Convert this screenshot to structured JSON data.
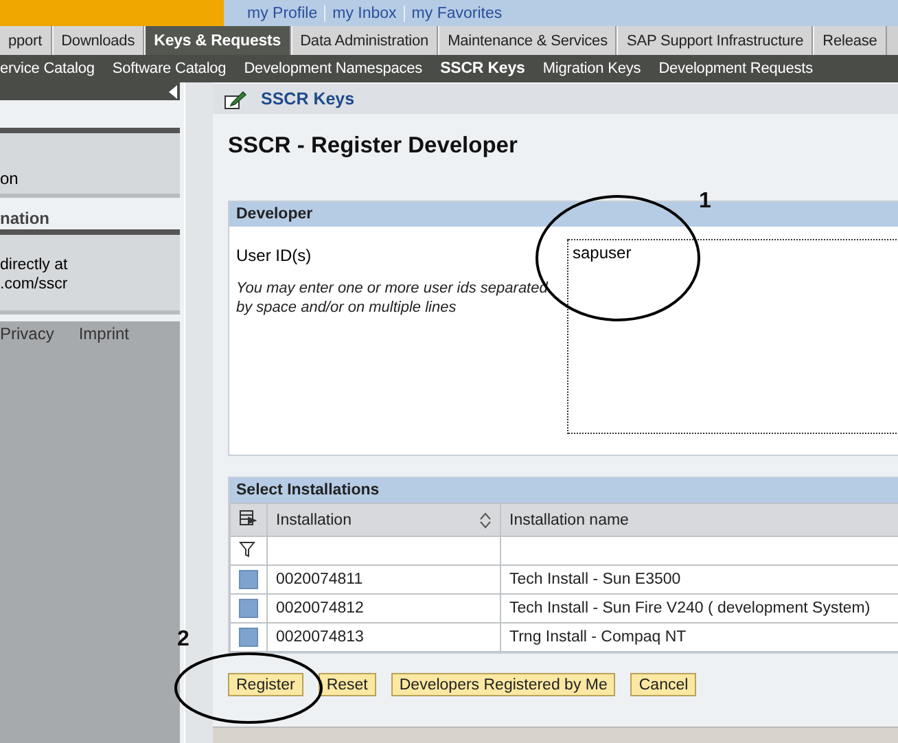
{
  "header": {
    "links": [
      "my Profile",
      "my Inbox",
      "my Favorites"
    ]
  },
  "tabs": [
    {
      "label": "pport",
      "selected": false
    },
    {
      "label": "Downloads",
      "selected": false
    },
    {
      "label": "Keys & Requests",
      "selected": true
    },
    {
      "label": "Data Administration",
      "selected": false
    },
    {
      "label": "Maintenance & Services",
      "selected": false
    },
    {
      "label": "SAP Support Infrastructure",
      "selected": false
    },
    {
      "label": "Release",
      "selected": false
    }
  ],
  "subnav": [
    {
      "label": "ervice Catalog",
      "selected": false
    },
    {
      "label": "Software Catalog",
      "selected": false
    },
    {
      "label": "Development Namespaces",
      "selected": false
    },
    {
      "label": "SSCR Keys",
      "selected": true
    },
    {
      "label": "Migration Keys",
      "selected": false
    },
    {
      "label": "Development Requests",
      "selected": false
    }
  ],
  "sidebar": {
    "box_1_text": "on",
    "section_heading": "nation",
    "box_2_lines": [
      "directly at",
      ".com/sscr"
    ],
    "footer_links": [
      "Privacy",
      "Imprint"
    ]
  },
  "page_header": {
    "title": "SSCR Keys"
  },
  "title": "SSCR - Register Developer",
  "developer": {
    "heading": "Developer",
    "label": "User ID(s)",
    "hint": "You may enter one or more user ids separated by space and/or on multiple lines",
    "value": "sapuser"
  },
  "installations": {
    "heading": "Select Installations",
    "columns": [
      "Installation",
      "Installation name"
    ],
    "rows": [
      {
        "cells": [
          "0020074811",
          "Tech Install - Sun E3500"
        ],
        "selected": false
      },
      {
        "cells": [
          "0020074812",
          "Tech Install - Sun Fire V240 ( development System)"
        ],
        "selected": false
      },
      {
        "cells": [
          "0020074813",
          "Trng Install - Compaq NT"
        ],
        "selected": false
      }
    ]
  },
  "buttons": [
    "Register",
    "Reset",
    "Developers Registered by Me",
    "Cancel"
  ],
  "annotations": [
    "1",
    "2"
  ]
}
